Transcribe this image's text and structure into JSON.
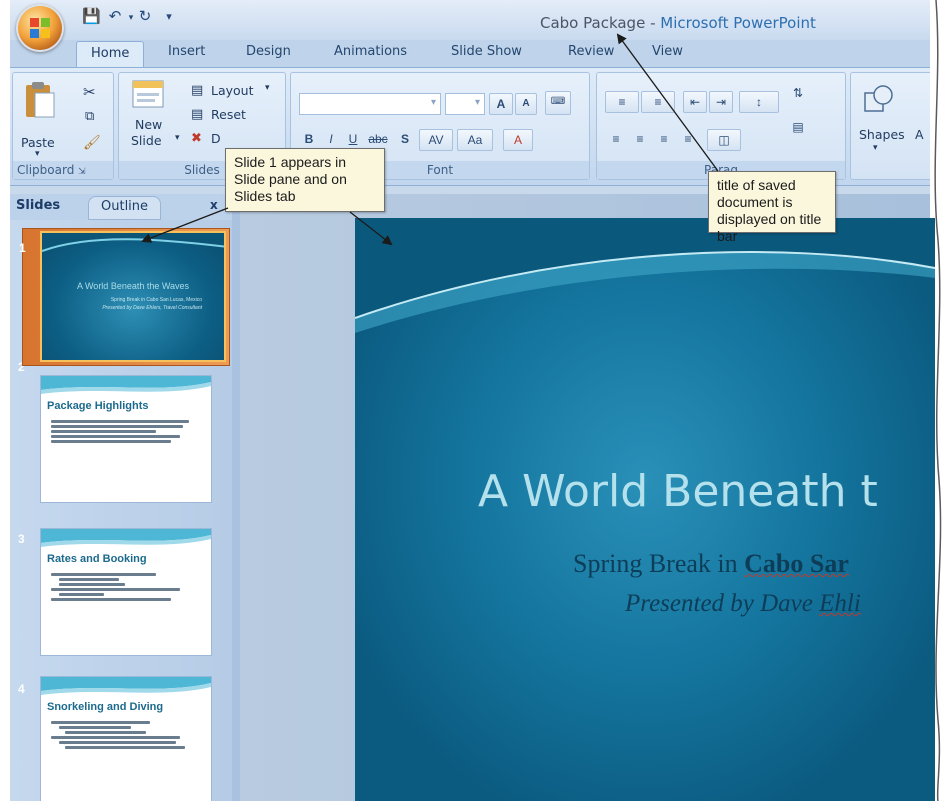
{
  "window": {
    "doc_title": "Cabo Package",
    "separator": " - ",
    "app_name": "Microsoft PowerPoint"
  },
  "tabs": [
    "Home",
    "Insert",
    "Design",
    "Animations",
    "Slide Show",
    "Review",
    "View"
  ],
  "ribbon": {
    "paste": "Paste",
    "new_slide_1": "New",
    "new_slide_2": "Slide",
    "layout": "Layout",
    "reset": "Reset",
    "delete_partial": "D",
    "font_size_up": "A",
    "font_size_down": "A",
    "bold": "B",
    "italic": "I",
    "underline": "U",
    "strike": "abc",
    "shadow": "S",
    "spacing": "AV",
    "change_case": "Aa",
    "font_color": "A",
    "shapes": "Shapes",
    "shapes_partial": "A",
    "groups": {
      "clipboard": "Clipboard",
      "slides": "Slides",
      "font": "Font",
      "paragraph": "Parag"
    }
  },
  "pane": {
    "tab_slides": "Slides",
    "tab_outline": "Outline",
    "close": "x",
    "thumbs": [
      {
        "num": "1",
        "title": "A World Beneath the Waves",
        "sub1": "Spring Break in Cabo San Lucas, Mexico",
        "sub2": "Presented by Dave Ehlers, Travel Consultant"
      },
      {
        "num": "2",
        "title": "Package Highlights"
      },
      {
        "num": "3",
        "title": "Rates and Booking"
      },
      {
        "num": "4",
        "title": "Snorkeling and Diving"
      }
    ]
  },
  "slide": {
    "title": "A World Beneath t",
    "sub1_plain": "Spring Break in ",
    "sub1_bold": "Cabo Sar",
    "sub2_plain": "Presented by Dave ",
    "sub2_err": "Ehli"
  },
  "callouts": {
    "slide1": "Slide 1 appears in Slide pane and on Slides tab",
    "title": "title of saved document is displayed on title bar"
  },
  "colors": {
    "accent": "#2d6fb0",
    "selection": "#e5853f",
    "slide_bg": "#1577a0",
    "callout_bg": "#fbf7dd"
  }
}
